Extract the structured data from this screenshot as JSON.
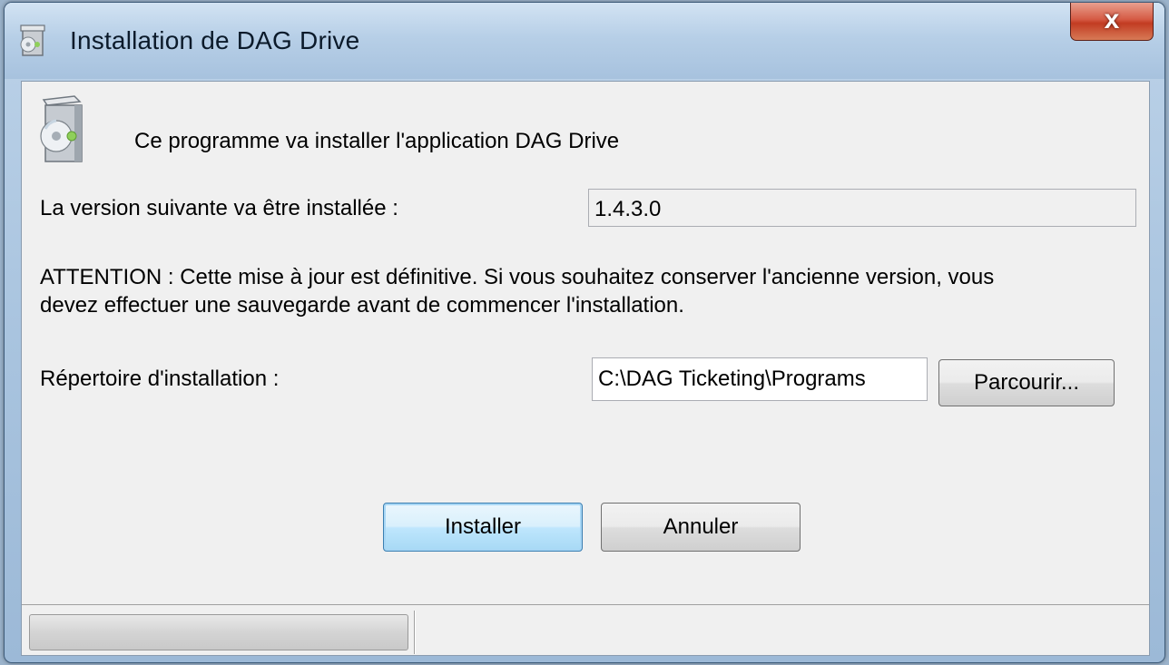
{
  "window": {
    "title": "Installation de DAG Drive",
    "close_glyph": "x"
  },
  "header": {
    "text": "Ce programme va installer l'application DAG Drive",
    "icon": "installer-disc-icon"
  },
  "version": {
    "label": "La version suivante va être installée :",
    "value": "1.4.3.0"
  },
  "warning": {
    "line1": "ATTENTION : Cette mise à jour est définitive. Si vous souhaitez conserver l'ancienne version, vous",
    "line2": "devez effectuer une sauvegarde avant de commencer l'installation."
  },
  "directory": {
    "label": "Répertoire d'installation :",
    "value": "C:\\DAG Ticketing\\Programs",
    "browse_label": "Parcourir..."
  },
  "actions": {
    "install_label": "Installer",
    "cancel_label": "Annuler"
  },
  "status": {
    "progress": 0
  },
  "colors": {
    "close_button": "#c23b22",
    "default_button_border": "#3c7fb1",
    "client_background": "#f0f0f0"
  }
}
